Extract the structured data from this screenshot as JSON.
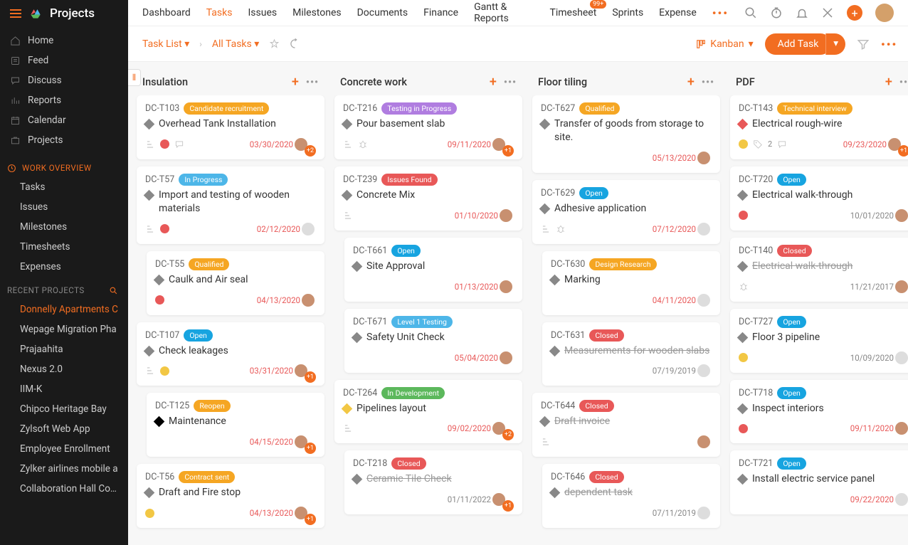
{
  "app_name": "Projects",
  "top_tabs": [
    "Dashboard",
    "Tasks",
    "Issues",
    "Milestones",
    "Documents",
    "Finance",
    "Gantt & Reports",
    "Timesheet",
    "Sprints",
    "Expense"
  ],
  "top_active": "Tasks",
  "timesheet_badge": "99+",
  "sidebar": {
    "main": [
      {
        "icon": "home",
        "label": "Home"
      },
      {
        "icon": "feed",
        "label": "Feed"
      },
      {
        "icon": "discuss",
        "label": "Discuss"
      },
      {
        "icon": "reports",
        "label": "Reports"
      },
      {
        "icon": "calendar",
        "label": "Calendar"
      },
      {
        "icon": "projects",
        "label": "Projects"
      }
    ],
    "overview_label": "WORK OVERVIEW",
    "overview": [
      "Tasks",
      "Issues",
      "Milestones",
      "Timesheets",
      "Expenses"
    ],
    "recent_label": "RECENT PROJECTS",
    "recent": [
      "Donnelly Apartments C",
      "Wepage Migration Pha",
      "Prajaahita",
      "Nexus 2.0",
      "IIM-K",
      "Chipco Heritage Bay",
      "Zylsoft Web App",
      "Employee Enrollment",
      "Zylker airlines mobile a",
      "Collaboration Hall Cons"
    ]
  },
  "crumbs": {
    "task_list": "Task List",
    "all_tasks": "All Tasks"
  },
  "view_selector": "Kanban",
  "add_task_label": "Add Task",
  "columns": [
    {
      "name": "Insulation",
      "cards": [
        {
          "id": "DC-T103",
          "status": "Candidate recruitment",
          "pill": "pill-orange",
          "diamond": "d-grey",
          "title": "Overhead Tank Installation",
          "icons": [
            "subtask",
            "prio-red",
            "comment"
          ],
          "date": "03/30/2020",
          "avatars": 2,
          "extra": "+2"
        },
        {
          "id": "DC-T57",
          "status": "In Progress",
          "pill": "pill-cyan",
          "diamond": "d-grey",
          "title": "Import and testing of wooden materials",
          "icons": [
            "subtask",
            "prio-red"
          ],
          "date": "02/12/2020",
          "avatars": 1,
          "empty_avatar": true
        },
        {
          "id": "DC-T55",
          "status": "Qualified",
          "pill": "pill-orange",
          "diamond": "d-grey",
          "title": "Caulk and Air seal",
          "icons": [
            "prio-red"
          ],
          "date": "04/13/2020",
          "avatars": 1,
          "sub": true
        },
        {
          "id": "DC-T107",
          "status": "Open",
          "pill": "pill-blue",
          "diamond": "d-grey",
          "title": "Check leakages",
          "icons": [
            "subtask",
            "prio-yellow"
          ],
          "date": "03/31/2020",
          "avatars": 1,
          "extra": "+1"
        },
        {
          "id": "DC-T125",
          "status": "Reopen",
          "pill": "pill-orange",
          "diamond": "d-black",
          "title": "Maintenance",
          "icons": [],
          "date": "04/15/2020",
          "avatars": 1,
          "extra": "+1",
          "sub": true
        },
        {
          "id": "DC-T56",
          "status": "Contract sent",
          "pill": "pill-orange",
          "diamond": "d-grey",
          "title": "Draft and Fire stop",
          "icons": [
            "prio-yellow"
          ],
          "date": "04/13/2020",
          "avatars": 1,
          "extra": "+1"
        }
      ]
    },
    {
      "name": "Concrete work",
      "cards": [
        {
          "id": "DC-T216",
          "status": "Testing in Progress",
          "pill": "pill-violet",
          "diamond": "d-grey",
          "title": "Pour basement slab",
          "icons": [
            "subtask",
            "bug"
          ],
          "date": "09/11/2020",
          "avatars": 1,
          "extra": "+1"
        },
        {
          "id": "DC-T239",
          "status": "Issues Found",
          "pill": "pill-red",
          "diamond": "d-grey",
          "title": "Concrete Mix",
          "icons": [
            "subtask"
          ],
          "date": "01/10/2020",
          "avatars": 1
        },
        {
          "id": "DC-T661",
          "status": "Open",
          "pill": "pill-blue",
          "diamond": "d-grey",
          "title": "Site Approval",
          "icons": [],
          "date": "01/13/2020",
          "avatars": 1,
          "sub": true
        },
        {
          "id": "DC-T671",
          "status": "Level 1 Testing",
          "pill": "pill-cyan",
          "diamond": "d-grey",
          "title": "Safety Unit Check",
          "icons": [],
          "date": "05/04/2020",
          "avatars": 1,
          "sub": true
        },
        {
          "id": "DC-T264",
          "status": "In Development",
          "pill": "pill-green",
          "diamond": "d-yellow",
          "title": "Pipelines layout",
          "icons": [
            "subtask"
          ],
          "date": "09/02/2020",
          "avatars": 1,
          "extra": "+2"
        },
        {
          "id": "DC-T218",
          "status": "Closed",
          "pill": "pill-red",
          "diamond": "d-grey",
          "title": "Ceramic Tile Check",
          "strike": true,
          "icons": [],
          "date": "01/11/2022",
          "date_grey": true,
          "avatars": 1,
          "extra": "+1",
          "sub": true
        }
      ]
    },
    {
      "name": "Floor tiling",
      "cards": [
        {
          "id": "DC-T627",
          "status": "Qualified",
          "pill": "pill-orange",
          "diamond": "d-grey",
          "title": "Transfer of goods from storage to site.",
          "icons": [],
          "date": "05/13/2020",
          "avatars": 1
        },
        {
          "id": "DC-T629",
          "status": "Open",
          "pill": "pill-blue",
          "diamond": "d-grey",
          "title": "Adhesive application",
          "icons": [
            "subtask",
            "bug"
          ],
          "date": "07/12/2020",
          "avatars": 1,
          "empty_avatar": true
        },
        {
          "id": "DC-T630",
          "status": "Design Research",
          "pill": "pill-orange",
          "diamond": "d-grey",
          "title": "Marking",
          "icons": [],
          "date": "04/11/2020",
          "avatars": 1,
          "empty_avatar": true,
          "sub": true
        },
        {
          "id": "DC-T631",
          "status": "Closed",
          "pill": "pill-red",
          "diamond": "d-grey",
          "title": "Measurements for wooden slabs",
          "strike": true,
          "icons": [],
          "date": "07/19/2019",
          "date_grey": true,
          "avatars": 1,
          "empty_avatar": true,
          "sub": true
        },
        {
          "id": "DC-T644",
          "status": "Closed",
          "pill": "pill-red",
          "diamond": "d-grey",
          "title": "Draft invoice",
          "strike": true,
          "icons": [
            "subtask"
          ],
          "date": "",
          "avatars": 1
        },
        {
          "id": "DC-T646",
          "status": "Closed",
          "pill": "pill-red",
          "diamond": "d-grey",
          "title": "dependent task",
          "strike": true,
          "icons": [],
          "date": "07/11/2019",
          "date_grey": true,
          "avatars": 1,
          "empty_avatar": true,
          "sub": true
        }
      ]
    },
    {
      "name": "PDF",
      "cards": [
        {
          "id": "DC-T143",
          "status": "Technical interview",
          "pill": "pill-orange",
          "diamond": "d-red",
          "title": "Electrical rough-wire",
          "icons": [
            "prio-yellow",
            "tag",
            "comment"
          ],
          "tag_count": "2",
          "date": "09/23/2020",
          "avatars": 1,
          "extra": "+1"
        },
        {
          "id": "DC-T720",
          "status": "Open",
          "pill": "pill-blue",
          "diamond": "d-grey",
          "title": "Electrical walk-through",
          "icons": [
            "prio-red"
          ],
          "date": "10/01/2020",
          "date_grey": true,
          "avatars": 1
        },
        {
          "id": "DC-T140",
          "status": "Closed",
          "pill": "pill-red",
          "diamond": "d-grey",
          "title": "Electrical walk-through",
          "strike": true,
          "icons": [
            "bug"
          ],
          "date": "11/21/2017",
          "date_grey": true,
          "avatars": 1
        },
        {
          "id": "DC-T727",
          "status": "Open",
          "pill": "pill-blue",
          "diamond": "d-grey",
          "title": "Floor 3 pipeline",
          "icons": [
            "prio-yellow"
          ],
          "date": "10/09/2020",
          "date_grey": true,
          "avatars": 1,
          "empty_avatar": true
        },
        {
          "id": "DC-T718",
          "status": "Open",
          "pill": "pill-blue",
          "diamond": "d-grey",
          "title": "Inspect interiors",
          "icons": [
            "prio-red"
          ],
          "date": "09/11/2020",
          "avatars": 1
        },
        {
          "id": "DC-T721",
          "status": "Open",
          "pill": "pill-blue",
          "diamond": "d-grey",
          "title": "Install electric service panel",
          "icons": [],
          "date": "09/22/2020",
          "avatars": 1,
          "empty_avatar": true
        }
      ]
    }
  ]
}
